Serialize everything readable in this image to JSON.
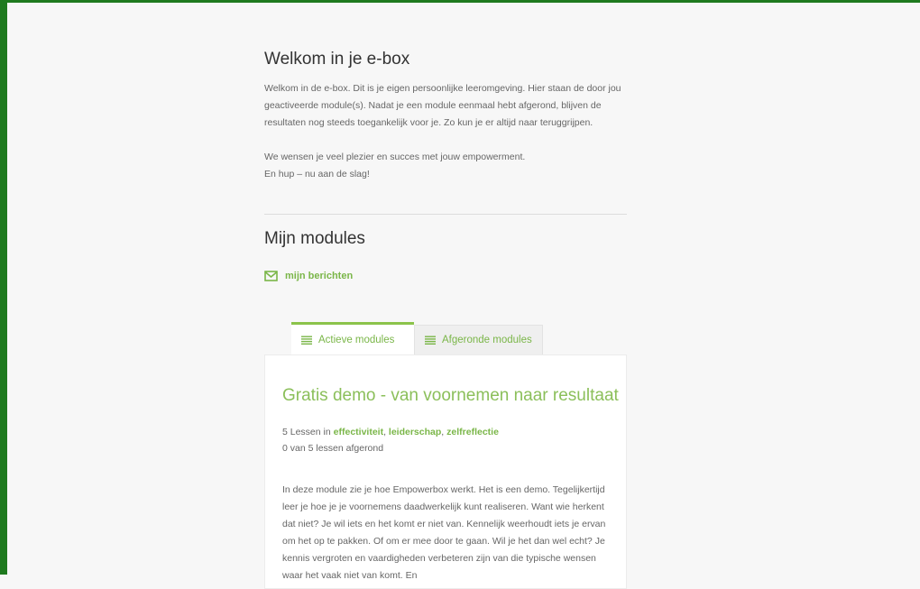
{
  "welcome": {
    "title": "Welkom in je e-box",
    "paragraph1": "Welkom in de e-box. Dit is je eigen persoonlijke leeromgeving. Hier staan de door jou geactiveerde module(s). Nadat je een module eenmaal hebt afgerond, blijven de resultaten nog steeds toegankelijk voor je. Zo kun je er altijd naar teruggrijpen.",
    "paragraph2_line1": "We wensen je veel plezier en succes met jouw empowerment.",
    "paragraph2_line2": "En hup – nu aan de slag!"
  },
  "modules": {
    "title": "Mijn modules",
    "messages_link": "mijn berichten",
    "messages_icon": "envelope-icon"
  },
  "tabs": [
    {
      "label": "Actieve modules",
      "icon": "list-icon",
      "active": true
    },
    {
      "label": "Afgeronde modules",
      "icon": "list-icon",
      "active": false
    }
  ],
  "module_card": {
    "title": "Gratis demo - van voornemen naar resultaat",
    "lessons_prefix": "5 Lessen in",
    "categories": [
      "effectiviteit",
      "leiderschap",
      "zelfreflectie"
    ],
    "separator": ", ",
    "progress_text": "0 van 5 lessen afgerond",
    "description": "In deze module zie je hoe Empowerbox werkt. Het is een demo. Tegelijkertijd leer je hoe je je voornemens daadwerkelijk kunt realiseren. Want wie herkent dat niet? Je wil iets en het komt er niet van. Kennelijk weerhoudt iets je ervan om het op te pakken. Of om er mee door te gaan. Wil je het dan wel echt? Je kennis vergroten en vaardigheden verbeteren zijn van die typische wensen waar het vaak niet van komt. En"
  },
  "colors": {
    "frame": "#1f7a1f",
    "accent": "#7ab648",
    "title_green": "#8bbf5a"
  }
}
